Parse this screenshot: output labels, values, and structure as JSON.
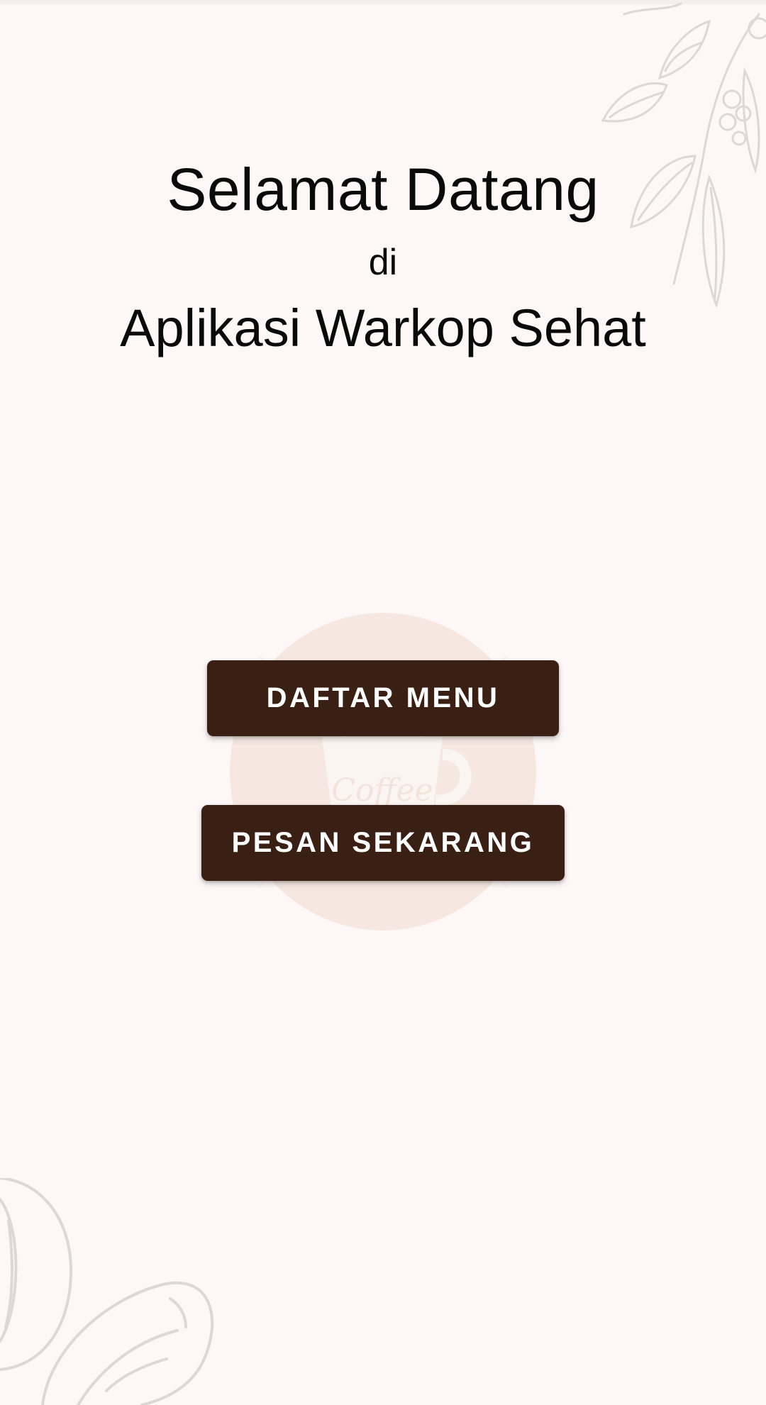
{
  "welcome": {
    "line1": "Selamat Datang",
    "line2": "di",
    "line3": "Aplikasi Warkop Sehat"
  },
  "buttons": {
    "menu_label": "DAFTAR MENU",
    "order_label": "PESAN SEKARANG"
  },
  "colors": {
    "background": "#fdf8f7",
    "button": "#3a1f14",
    "button_text": "#ffffff",
    "logo_circle": "#f6e8e1",
    "sketch_lines": "#d9d4d2"
  },
  "icons": {
    "top_right": "coffee-leaves-sketch",
    "center": "coffee-cup-logo",
    "bottom_left": "coffee-beans-sketch"
  }
}
